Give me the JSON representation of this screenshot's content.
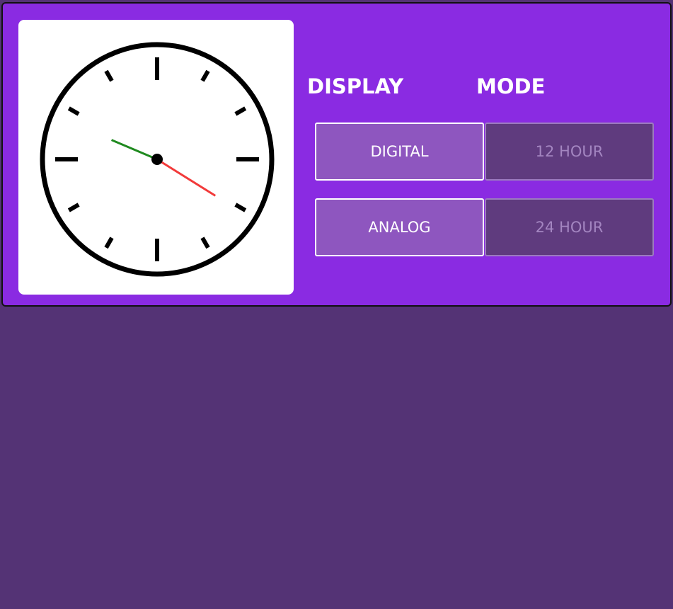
{
  "colors": {
    "page_background": "#543375",
    "panel_background": "#8a2be2",
    "clock_card": "#ffffff",
    "active_button": "#8e56bf",
    "inactive_button": "#5f3b7e",
    "hour_hand": "#1f8a1f",
    "minute_hand": "#f23a3a"
  },
  "clock": {
    "type": "analog",
    "hour_hand_angle_deg": 293,
    "minute_hand_angle_deg": 122
  },
  "display": {
    "heading": "DISPLAY",
    "options": [
      {
        "label": "DIGITAL",
        "state": "active"
      },
      {
        "label": "ANALOG",
        "state": "active"
      }
    ]
  },
  "mode": {
    "heading": "MODE",
    "options": [
      {
        "label": "12 HOUR",
        "state": "inactive"
      },
      {
        "label": "24 HOUR",
        "state": "inactive"
      }
    ]
  }
}
